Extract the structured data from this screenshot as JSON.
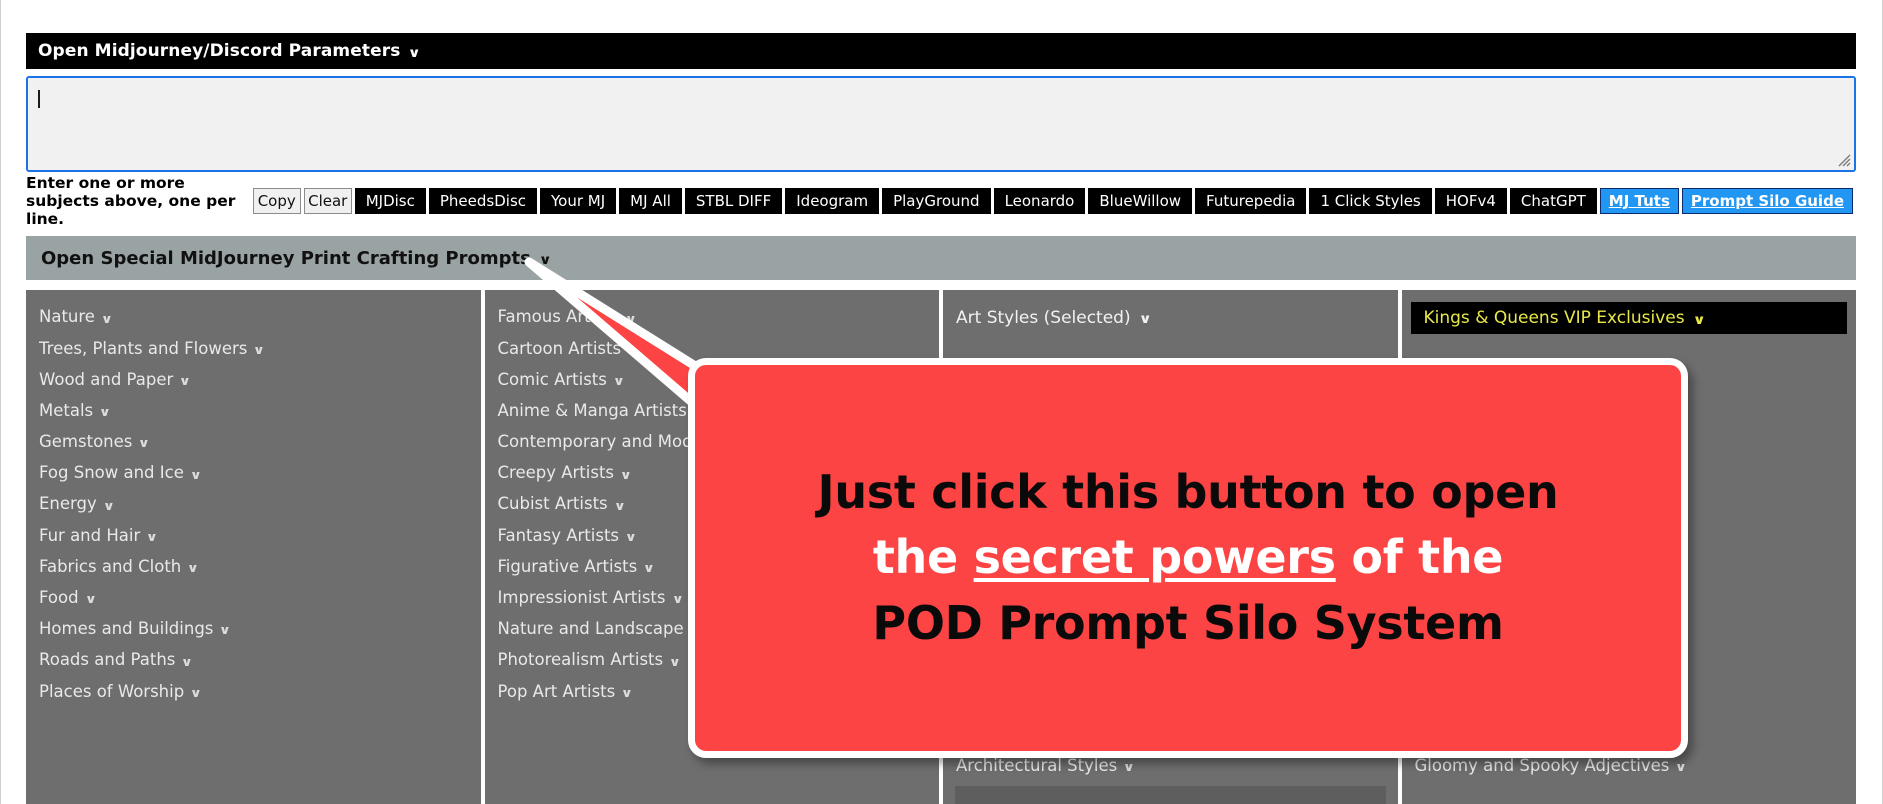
{
  "top_bar": {
    "label": "Open Midjourney/Discord Parameters",
    "chevron": "chevron-down-icon",
    "chevron_glyph": "∨",
    "bg_color": "#000000",
    "text_color": "#ffffff"
  },
  "subject_input": {
    "value": "",
    "placeholder": "",
    "focus_border_color": "#1a73e8",
    "background": "#f1f1f1"
  },
  "toolbar": {
    "hint": "Enter one or more subjects above, one per line.",
    "gray_buttons": [
      {
        "label": "Copy",
        "name": "copy-button"
      },
      {
        "label": "Clear",
        "name": "clear-button"
      }
    ],
    "black_buttons": [
      {
        "label": "MJDisc",
        "name": "mjdisc-button"
      },
      {
        "label": "PheedsDisc",
        "name": "pheedsdisc-button"
      },
      {
        "label": "Your MJ",
        "name": "your-mj-button"
      },
      {
        "label": "MJ All",
        "name": "mj-all-button"
      },
      {
        "label": "STBL DIFF",
        "name": "stbl-diff-button"
      },
      {
        "label": "Ideogram",
        "name": "ideogram-button"
      },
      {
        "label": "PlayGround",
        "name": "playground-button"
      },
      {
        "label": "Leonardo",
        "name": "leonardo-button"
      },
      {
        "label": "BlueWillow",
        "name": "bluewillow-button"
      },
      {
        "label": "Futurepedia",
        "name": "futurepedia-button"
      },
      {
        "label": "1 Click Styles",
        "name": "one-click-styles-button"
      },
      {
        "label": "HOFv4",
        "name": "hofv4-button"
      },
      {
        "label": "ChatGPT",
        "name": "chatgpt-button"
      }
    ],
    "link_buttons": [
      {
        "label": "MJ Tuts",
        "name": "mj-tuts-link"
      },
      {
        "label": "Prompt Silo Guide",
        "name": "prompt-silo-guide-link"
      }
    ],
    "link_bg_color": "#2196f3"
  },
  "section_bar": {
    "label": "Open Special MidJourney Print Crafting Prompts",
    "chevron_glyph": "∨",
    "bg_color": "#9aa3a3"
  },
  "columns": [
    {
      "name": "column-nature",
      "items": [
        "Nature",
        "Trees, Plants and Flowers",
        "Wood and Paper",
        "Metals",
        "Gemstones",
        "Fog Snow and Ice",
        "Energy",
        "Fur and Hair",
        "Fabrics and Cloth",
        "Food",
        "Homes and Buildings",
        "Roads and Paths",
        "Places of Worship"
      ]
    },
    {
      "name": "column-artists",
      "items": [
        "Famous Artists",
        "Cartoon Artists",
        "Comic Artists",
        "Anime & Manga Artists",
        "Contemporary and Modern Artists",
        "Creepy Artists",
        "Cubist Artists",
        "Fantasy Artists",
        "Figurative Artists",
        "Impressionist Artists",
        "Nature and Landscape Artists",
        "Photorealism Artists",
        "Pop Art Artists"
      ]
    },
    {
      "name": "column-art-styles",
      "header": "Art Styles (Selected)",
      "items": [],
      "bottom_item": "Architectural Styles"
    },
    {
      "name": "column-vip",
      "header": "Kings & Queens VIP Exclusives",
      "header_style": "vip",
      "header_bg": "#000000",
      "header_color": "#e8e84a",
      "items": [],
      "bottom_item": "Gloomy and Spooky Adjectives"
    }
  ],
  "callout": {
    "line1": "Just click this button to open",
    "line2_pre": "the ",
    "line2_underlined": "secret powers",
    "line2_post": " of the",
    "line3": "POD Prompt Silo System",
    "bg_color": "#fc4444",
    "border_color": "#ffffff"
  },
  "chevron_glyph": "∨"
}
